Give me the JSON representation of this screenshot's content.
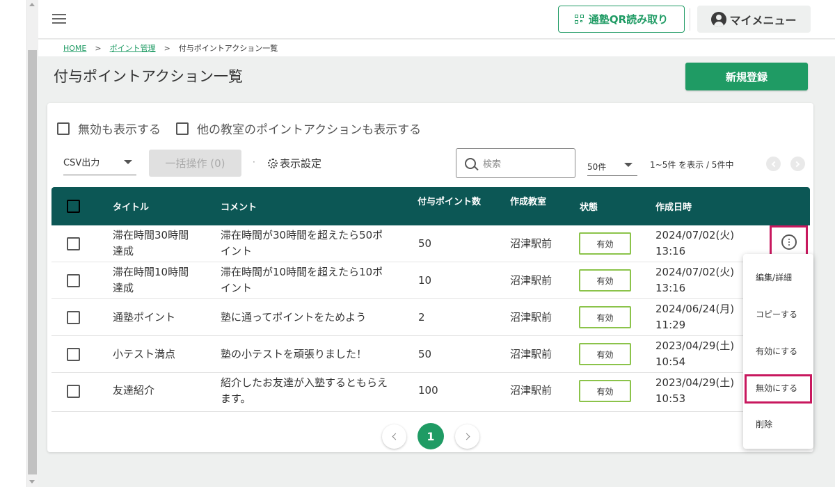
{
  "header": {
    "qr_button_label": "通塾QR読み取り",
    "mymenu_label": "マイメニュー"
  },
  "breadcrumb": {
    "items": [
      "HOME",
      "ポイント管理",
      "付与ポイントアクション一覧"
    ],
    "separator": ">"
  },
  "page": {
    "title": "付与ポイントアクション一覧",
    "new_button_label": "新規登録"
  },
  "filters": {
    "show_disabled_label": "無効も表示する",
    "show_other_classrooms_label": "他の教室のポイントアクションも表示する"
  },
  "toolbar": {
    "csv_select_value": "CSV出力",
    "bulk_button_label": "一括操作 (0)",
    "separator": "·",
    "display_settings_label": "表示設定",
    "search_placeholder": "検索",
    "perpage_value": "50件",
    "range_text": "1~5件 を表示 / 5件中"
  },
  "table": {
    "headers": [
      "タイトル",
      "コメント",
      "付与ポイント数",
      "作成教室",
      "状態",
      "作成日時"
    ],
    "rows": [
      {
        "title_line1": "滞在時間30時間",
        "title_line2": "達成",
        "comment_line1": "滞在時間が30時間を超えたら50ポ",
        "comment_line2": "イント",
        "points": "50",
        "classroom": "沼津駅前",
        "status": "有効",
        "date_line1": "2024/07/02(火)",
        "date_line2": "13:16"
      },
      {
        "title_line1": "滞在時間10時間",
        "title_line2": "達成",
        "comment_line1": "滞在時間が10時間を超えたら10ポ",
        "comment_line2": "イント",
        "points": "10",
        "classroom": "沼津駅前",
        "status": "有効",
        "date_line1": "2024/07/02(火)",
        "date_line2": "13:16"
      },
      {
        "title_line1": "通塾ポイント",
        "title_line2": "",
        "comment_line1": "塾に通ってポイントをためよう",
        "comment_line2": "",
        "points": "2",
        "classroom": "沼津駅前",
        "status": "有効",
        "date_line1": "2024/06/24(月)",
        "date_line2": "11:29"
      },
      {
        "title_line1": "小テスト満点",
        "title_line2": "",
        "comment_line1": "塾の小テストを頑張りました！",
        "comment_line2": "",
        "points": "50",
        "classroom": "沼津駅前",
        "status": "有効",
        "date_line1": "2023/04/29(土)",
        "date_line2": "10:54"
      },
      {
        "title_line1": "友達紹介",
        "title_line2": "",
        "comment_line1": "紹介したお友達が入塾するともらえ",
        "comment_line2": "ます。",
        "points": "100",
        "classroom": "沼津駅前",
        "status": "有効",
        "date_line1": "2023/04/29(土)",
        "date_line2": "10:53"
      }
    ]
  },
  "context_menu": {
    "items": [
      "編集/詳細",
      "コピーする",
      "有効にする",
      "無効にする",
      "削除"
    ],
    "highlighted": "無効にする"
  },
  "pagination": {
    "current_page": "1"
  },
  "colors": {
    "brand_green": "#1f9b64",
    "table_header": "#0c5755",
    "status_border": "#8bc34a",
    "highlight": "#c8185e"
  }
}
